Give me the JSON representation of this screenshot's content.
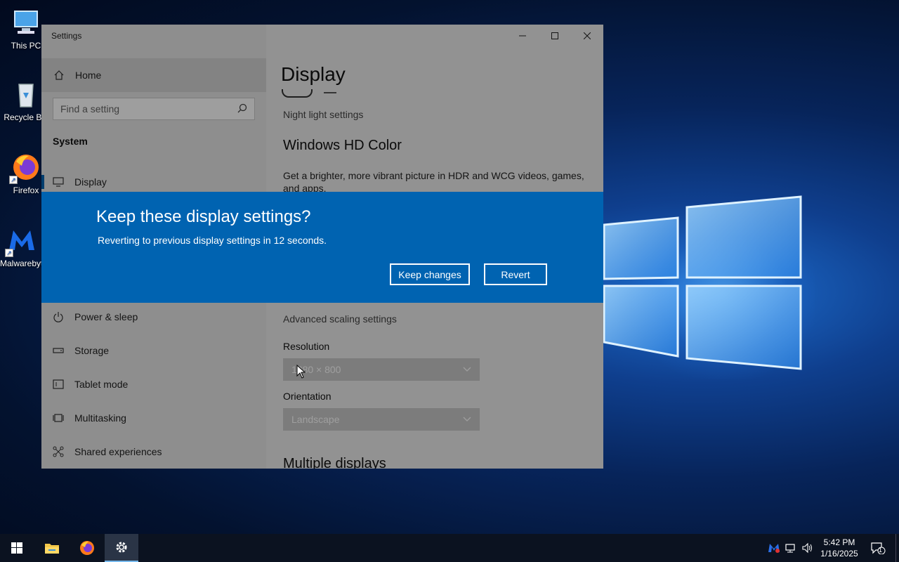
{
  "desktop": {
    "icons": [
      {
        "label": "This PC"
      },
      {
        "label": "Recycle Bin"
      },
      {
        "label": "Firefox"
      },
      {
        "label": "Malwarebytes"
      }
    ]
  },
  "window": {
    "title": "Settings",
    "sidebar": {
      "home_label": "Home",
      "search_placeholder": "Find a setting",
      "section_heading": "System",
      "items": [
        {
          "label": "Display",
          "icon": "monitor-icon"
        },
        {
          "label": "Power & sleep",
          "icon": "power-icon"
        },
        {
          "label": "Storage",
          "icon": "storage-icon"
        },
        {
          "label": "Tablet mode",
          "icon": "tablet-icon"
        },
        {
          "label": "Multitasking",
          "icon": "multitasking-icon"
        },
        {
          "label": "Shared experiences",
          "icon": "shared-icon"
        }
      ]
    },
    "content": {
      "page_title": "Display",
      "night_light_link": "Night light settings",
      "hd_color_heading": "Windows HD Color",
      "hd_color_desc": "Get a brighter, more vibrant picture in HDR and WCG videos, games, and apps.",
      "advanced_scaling_link": "Advanced scaling settings",
      "resolution_label": "Resolution",
      "resolution_value": "1280 × 800",
      "orientation_label": "Orientation",
      "orientation_value": "Landscape",
      "multiple_displays_heading": "Multiple displays"
    }
  },
  "dialog": {
    "title": "Keep these display settings?",
    "message": "Reverting to previous display settings in 12 seconds.",
    "keep_label": "Keep changes",
    "revert_label": "Revert",
    "countdown_seconds": 12,
    "accent_color": "#0063b1"
  },
  "taskbar": {
    "time": "5:42 PM",
    "date": "1/16/2025",
    "notification_count": "1"
  }
}
